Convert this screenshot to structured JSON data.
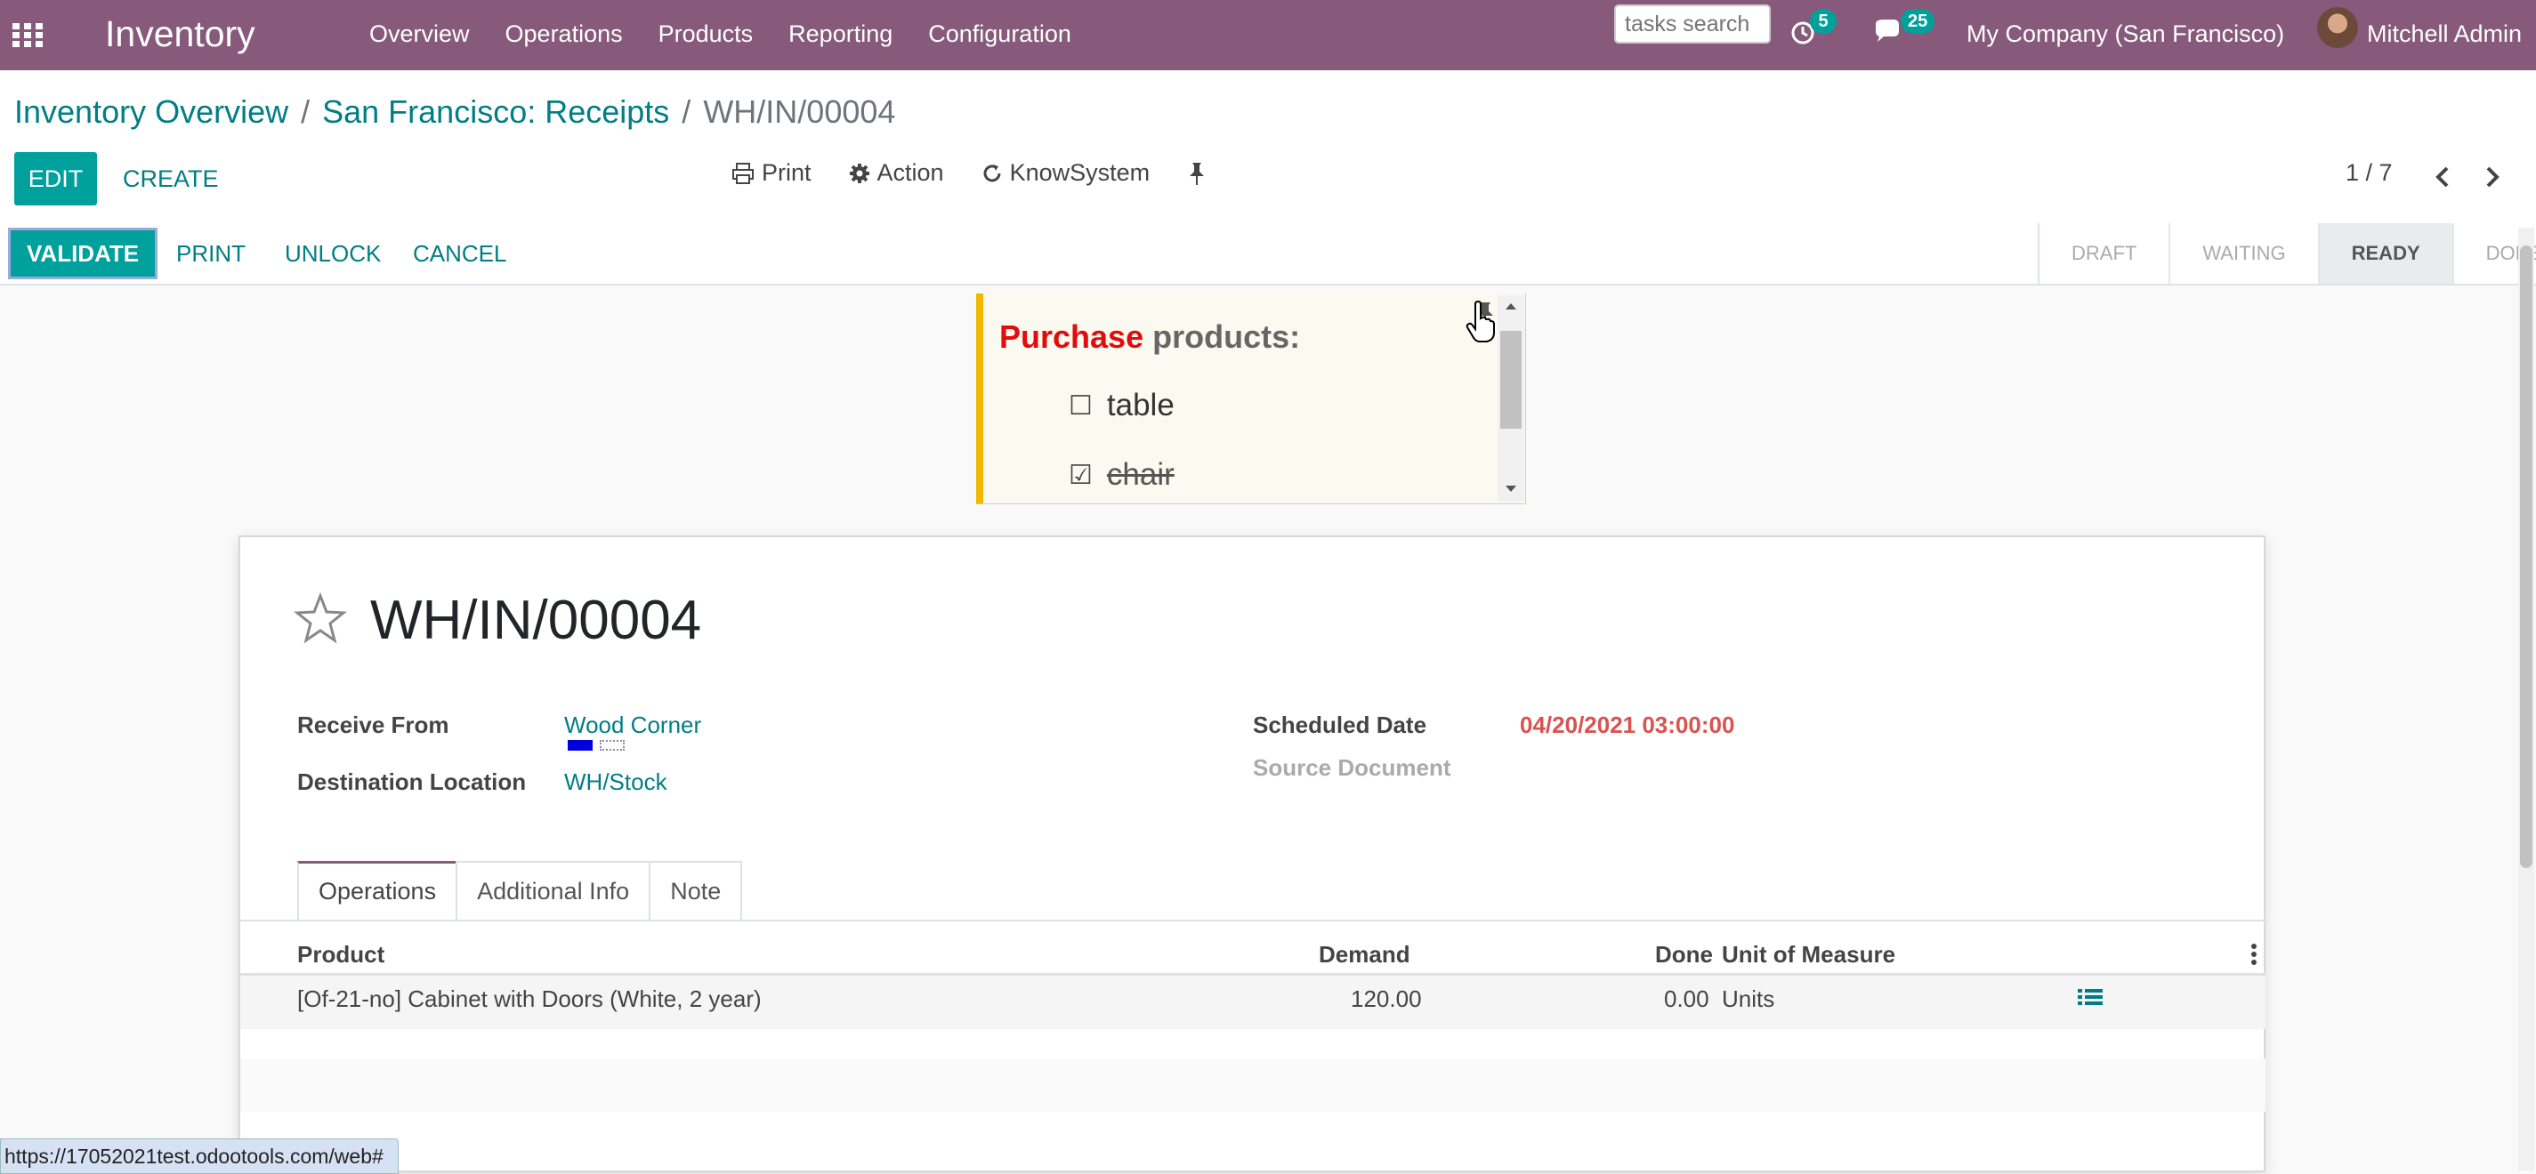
{
  "navbar": {
    "app_name": "Inventory",
    "menu": [
      "Overview",
      "Operations",
      "Products",
      "Reporting",
      "Configuration"
    ],
    "tasks_search_placeholder": "tasks search",
    "activity_count": "5",
    "messages_count": "25",
    "company": "My Company (San Francisco)",
    "user": "Mitchell Admin"
  },
  "breadcrumb": {
    "items": [
      "Inventory Overview",
      "San Francisco: Receipts"
    ],
    "separator": "/",
    "current": "WH/IN/00004"
  },
  "buttons": {
    "edit": "EDIT",
    "create": "CREATE"
  },
  "actions": {
    "print": "Print",
    "action": "Action",
    "knowsystem": "KnowSystem"
  },
  "pager": {
    "value": "1 / 7"
  },
  "statusbar": {
    "buttons": [
      "VALIDATE",
      "PRINT",
      "UNLOCK",
      "CANCEL"
    ],
    "stages": [
      "DRAFT",
      "WAITING",
      "READY",
      "DONE"
    ],
    "active_stage": "READY"
  },
  "note": {
    "title_highlight": "Purchase",
    "title_rest": " products:",
    "items": [
      {
        "checkbox": "☐",
        "text": "table",
        "done": false
      },
      {
        "checkbox": "☑",
        "text": "chair",
        "done": true
      }
    ]
  },
  "record": {
    "name": "WH/IN/00004",
    "receive_from_label": "Receive From",
    "receive_from": "Wood Corner",
    "destination_label": "Destination Location",
    "destination": "WH/Stock",
    "scheduled_date_label": "Scheduled Date",
    "scheduled_date": "04/20/2021 03:00:00",
    "source_document_label": "Source Document"
  },
  "tabs": [
    "Operations",
    "Additional Info",
    "Note"
  ],
  "table": {
    "headers": {
      "product": "Product",
      "demand": "Demand",
      "done": "Done",
      "uom": "Unit of Measure"
    },
    "rows": [
      {
        "product": "[Of-21-no] Cabinet with Doors (White, 2 year)",
        "demand": "120.00",
        "done": "0.00",
        "uom": "Units"
      }
    ]
  },
  "status_url": "https://17052021test.odootools.com/web#",
  "colors": {
    "navbar": "#875a7b",
    "primary": "#00a09d",
    "link": "#017e84",
    "date": "#d9534f"
  }
}
